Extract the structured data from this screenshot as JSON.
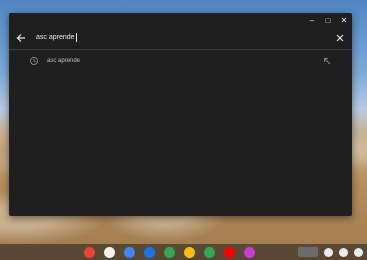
{
  "search": {
    "query": "asc aprende"
  },
  "suggestions": [
    {
      "text": "asc aprende"
    }
  ],
  "window_controls": {
    "minimize": "–",
    "maximize": "□",
    "close": "✕"
  },
  "shelf": {
    "apps": [
      {
        "name": "chrome",
        "color": "#ea4335"
      },
      {
        "name": "gmail",
        "color": "#f1f1f1"
      },
      {
        "name": "calendar",
        "color": "#4285f4"
      },
      {
        "name": "files",
        "color": "#1a73e8"
      },
      {
        "name": "chat",
        "color": "#34a853"
      },
      {
        "name": "photos",
        "color": "#fbbc05"
      },
      {
        "name": "play-store",
        "color": "#34a853"
      },
      {
        "name": "youtube",
        "color": "#ff0000"
      },
      {
        "name": "app",
        "color": "#c53ed1"
      }
    ]
  }
}
